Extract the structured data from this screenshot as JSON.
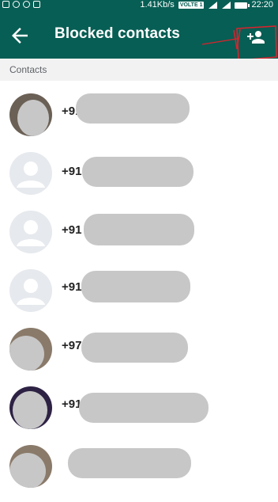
{
  "status_bar": {
    "speed": "1.41Kb/s",
    "volte": "VOLTE 1",
    "time": "22:20"
  },
  "app_bar": {
    "title": "Blocked contacts",
    "back_icon": "arrow-left-icon",
    "add_icon": "person-add-icon"
  },
  "section": {
    "label": "Contacts"
  },
  "contacts": [
    {
      "number": "+91"
    },
    {
      "number": "+91"
    },
    {
      "number": "+91"
    },
    {
      "number": "+91"
    },
    {
      "number": "+97"
    },
    {
      "number": "+91"
    },
    {
      "number": ""
    }
  ],
  "colors": {
    "primary": "#075e54",
    "section_bg": "#f2f2f2",
    "redaction": "#c7c7c7",
    "annotation": "#d9232d"
  }
}
